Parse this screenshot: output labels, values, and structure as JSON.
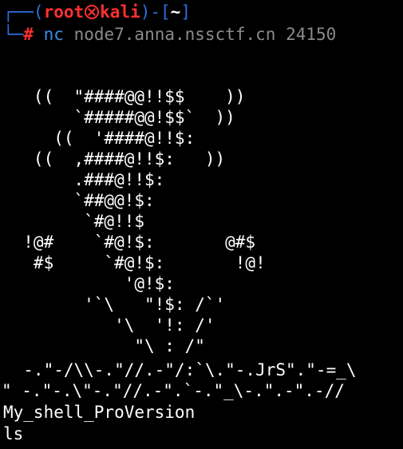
{
  "prompt": {
    "frame_open": "┌──(",
    "user": "root",
    "host": "kali",
    "frame_mid": ")-[",
    "cwd": "~",
    "frame_close": "]",
    "branch": "└─",
    "hash": "#",
    "command": "nc",
    "args": "node7.anna.nssctf.cn 24150",
    "skull_icon": "kali-skull-icon"
  },
  "ascii_art": [
    "   ((  \"####@@!!$$    ))",
    "       `#####@@!$$`  ))",
    "     ((  '####@!!$:",
    "   ((  ,####@!!$:   ))",
    "       .###@!!$:",
    "       `##@@!$:",
    "        `#@!!$",
    "  !@#    `#@!$:       @#$",
    "   #$     `#@!$:       !@!",
    "            '@!$:",
    "        '`\\   \"!$: /`'",
    "           '\\  '!: /'",
    "             \"\\ : /\"",
    "  -.\"-/\\\\-.\"//.-\"/:`\\.\"-.JrS\".\"-=_\\",
    "\" -.\"-.\\\"-.\"//.-\".`-.\"_\\-.\".-\".-//"
  ],
  "output": {
    "banner": "My_shell_ProVersion",
    "input": "ls"
  },
  "colors": {
    "background": "#000000",
    "frame": "#2f6fe0",
    "user_host": "#ff3030",
    "command": "#3f8ae8",
    "args": "#8a8a8a",
    "text": "#ffffff"
  }
}
